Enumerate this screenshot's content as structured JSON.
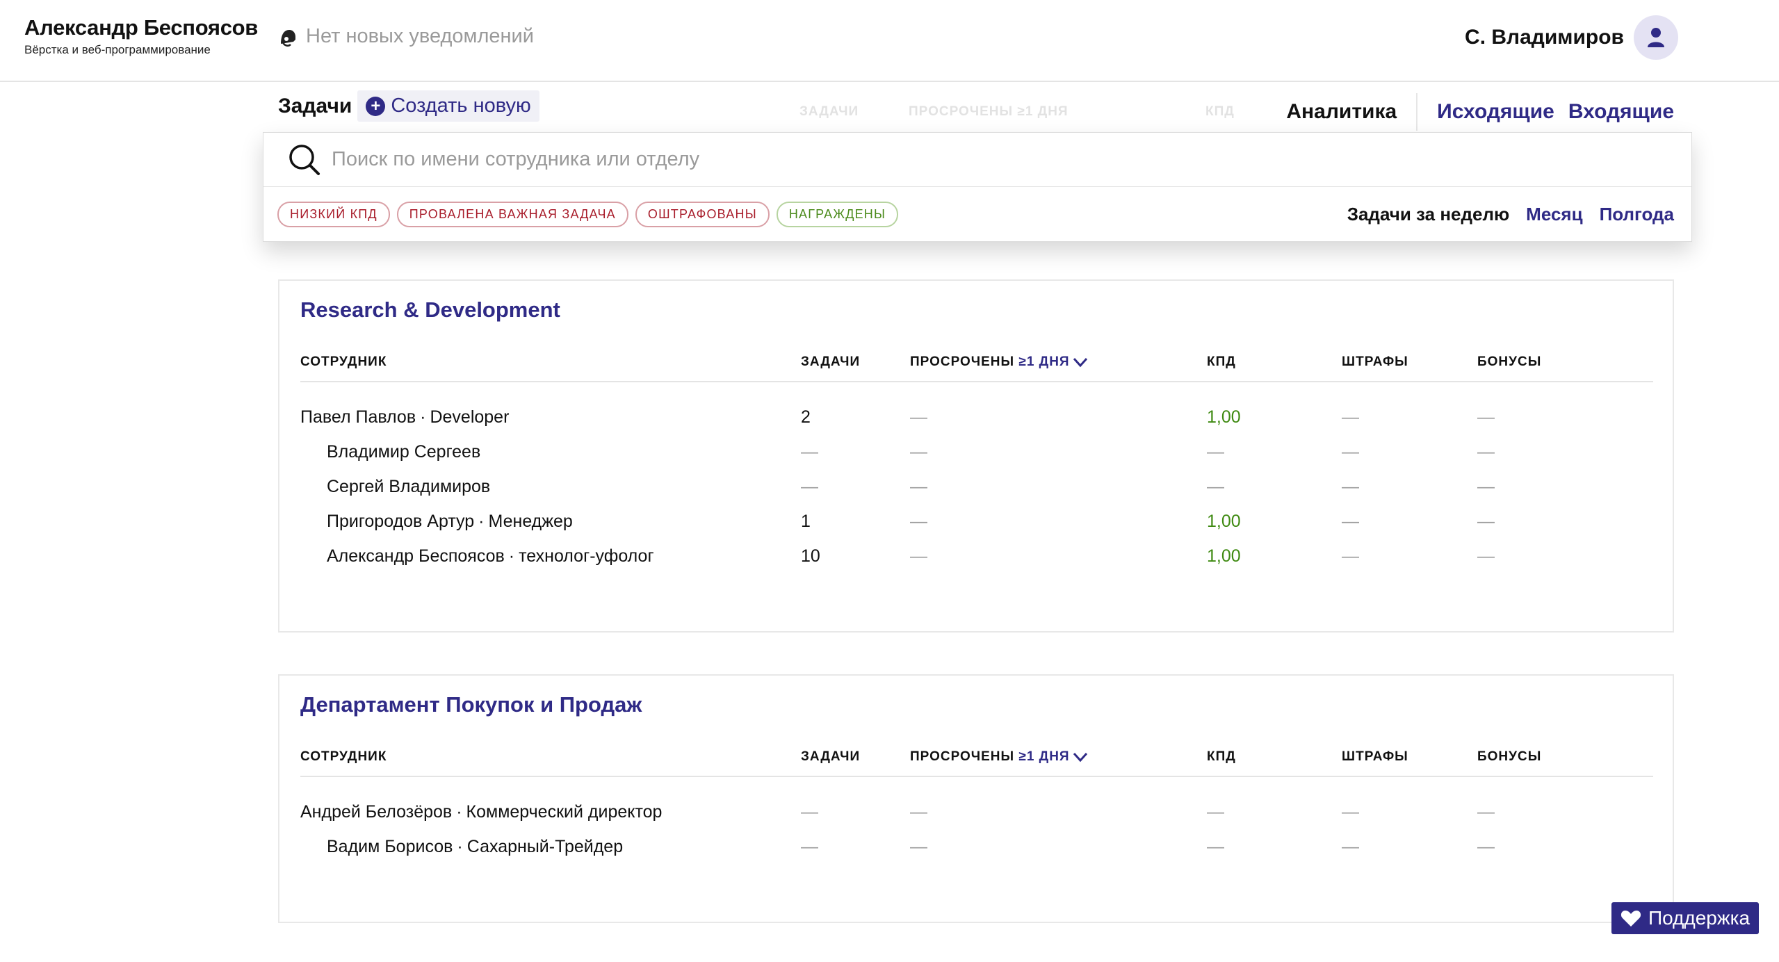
{
  "header": {
    "brand_name": "Александр Беспоясов",
    "brand_subtitle": "Вёрстка и веб-программирование",
    "notifications_text": "Нет новых уведомлений",
    "user_name": "С. Владимиров"
  },
  "subnav": {
    "tasks_title": "Задачи",
    "create_new": "Создать новую",
    "analytics": "Аналитика",
    "outgoing": "Исходящие",
    "incoming": "Входящие"
  },
  "search": {
    "placeholder": "Поиск по имени сотрудника или отделу"
  },
  "filters": [
    "НИЗКИЙ КПД",
    "ПРОВАЛЕНА ВАЖНАЯ ЗАДАЧА",
    "ОШТРАФОВАНЫ",
    "НАГРАЖДЕНЫ"
  ],
  "period": {
    "active": "Задачи за неделю",
    "month": "Месяц",
    "half_year": "Полгода"
  },
  "table_headers": {
    "employee": "СОТРУДНИК",
    "tasks": "ЗАДАЧИ",
    "overdue": "ПРОСРОЧЕНЫ",
    "overdue_filter": "≥1 ДНЯ",
    "kpd": "КПД",
    "fines": "ШТРАФЫ",
    "bonuses": "БОНУСЫ"
  },
  "departments": [
    {
      "title": "Research & Development",
      "rows": [
        {
          "name": "Павел Павлов",
          "role": "Developer",
          "tasks": "2",
          "overdue": "—",
          "kpd": "1,00",
          "fines": "—",
          "bonuses": "—"
        },
        {
          "name": "Владимир Сергеев",
          "role": "",
          "tasks": "—",
          "overdue": "—",
          "kpd": "—",
          "fines": "—",
          "bonuses": "—"
        },
        {
          "name": "Сергей Владимиров",
          "role": "",
          "tasks": "—",
          "overdue": "—",
          "kpd": "—",
          "fines": "—",
          "bonuses": "—"
        },
        {
          "name": "Пригородов Артур",
          "role": "Менеджер",
          "tasks": "1",
          "overdue": "—",
          "kpd": "1,00",
          "fines": "—",
          "bonuses": "—"
        },
        {
          "name": "Александр Беспоясов",
          "role": "технолог-уфолог",
          "tasks": "10",
          "overdue": "—",
          "kpd": "1,00",
          "fines": "—",
          "bonuses": "—"
        }
      ]
    },
    {
      "title": "Департамент Покупок и Продаж",
      "rows": [
        {
          "name": "Андрей Белозёров",
          "role": "Коммерческий директор",
          "tasks": "—",
          "overdue": "—",
          "kpd": "—",
          "fines": "—",
          "bonuses": "—"
        },
        {
          "name": "Вадим Борисов",
          "role": "Сахарный-Трейдер",
          "tasks": "—",
          "overdue": "—",
          "kpd": "—",
          "fines": "—",
          "bonuses": "—"
        }
      ]
    }
  ],
  "support_label": "Поддержка",
  "colors": {
    "accent": "#2f2a86",
    "positive": "#3f8a12",
    "danger": "#a81c2a"
  }
}
